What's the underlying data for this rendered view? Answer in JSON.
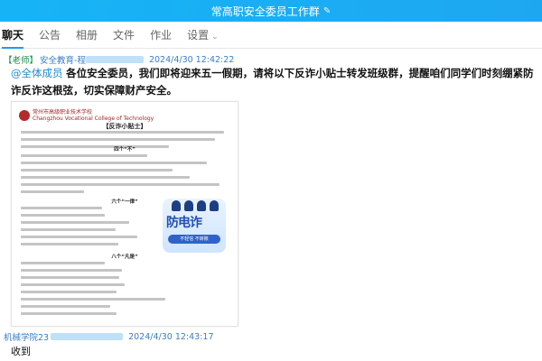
{
  "window": {
    "title": "常高职安全委员工作群",
    "edit_icon": "pencil-icon"
  },
  "tabs": [
    {
      "label": "聊天",
      "active": true
    },
    {
      "label": "公告"
    },
    {
      "label": "相册"
    },
    {
      "label": "文件"
    },
    {
      "label": "作业"
    },
    {
      "label": "设置",
      "has_dropdown": true
    }
  ],
  "messages": [
    {
      "tag": "【老师】",
      "sender": "安全教育-程",
      "time": "2024/4/30 12:42:22",
      "mention": "@全体成员",
      "text": "各位安全委员，我们即将迎来五一假期，请将以下反诈小贴士转发班级群，提醒咱们同学们时刻绷紧防诈反诈这根弦，切实保障财产安全。",
      "image": {
        "logo_text": "常州市高级职业技术学校",
        "logo_text_en": "Changzhou Vocational College of Technology",
        "title": "【反诈小贴士】",
        "section1": "四个“不”",
        "section2": "六个“一律”",
        "section3": "八个“凡是”",
        "badge": "防电诈",
        "badge_slogan": "不轻信 不转账"
      }
    },
    {
      "sender": "机械学院23",
      "time": "2024/4/30 12:43:17",
      "text": "收到"
    }
  ],
  "colors": {
    "accent": "#1a9df0",
    "titlebar": "#1ea7f1",
    "link": "#3a7dc9"
  }
}
